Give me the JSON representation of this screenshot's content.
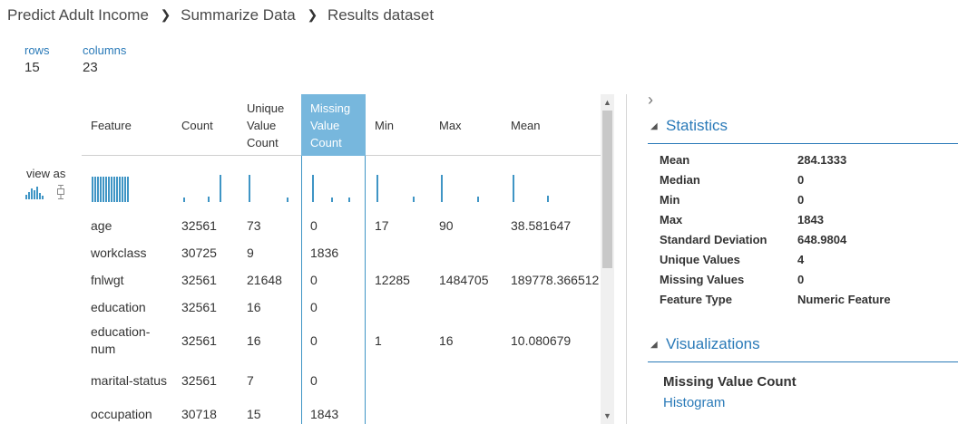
{
  "breadcrumb": [
    "Predict Adult Income",
    "Summarize Data",
    "Results dataset"
  ],
  "rows": {
    "label": "rows",
    "value": "15"
  },
  "columns": {
    "label": "columns",
    "value": "23"
  },
  "view_as": "view as",
  "headers": [
    "Feature",
    "Count",
    "Unique Value Count",
    "Missing Value Count",
    "Min",
    "Max",
    "Mean"
  ],
  "selected_column": "Missing Value Count",
  "table_rows": [
    [
      "age",
      "32561",
      "73",
      "0",
      "17",
      "90",
      "38.581647"
    ],
    [
      "workclass",
      "30725",
      "9",
      "1836",
      "",
      "",
      ""
    ],
    [
      "fnlwgt",
      "32561",
      "21648",
      "0",
      "12285",
      "1484705",
      "189778.366512"
    ],
    [
      "education",
      "32561",
      "16",
      "0",
      "",
      "",
      ""
    ],
    [
      "education-num",
      "32561",
      "16",
      "0",
      "1",
      "16",
      "10.080679"
    ],
    [
      "marital-status",
      "32561",
      "7",
      "0",
      "",
      "",
      ""
    ],
    [
      "occupation",
      "30718",
      "15",
      "1843",
      "",
      "",
      ""
    ]
  ],
  "statistics": {
    "title": "Statistics",
    "items": [
      {
        "k": "Mean",
        "v": "284.1333"
      },
      {
        "k": "Median",
        "v": "0"
      },
      {
        "k": "Min",
        "v": "0"
      },
      {
        "k": "Max",
        "v": "1843"
      },
      {
        "k": "Standard Deviation",
        "v": "648.9804"
      },
      {
        "k": "Unique Values",
        "v": "4"
      },
      {
        "k": "Missing Values",
        "v": "0"
      },
      {
        "k": "Feature Type",
        "v": "Numeric Feature"
      }
    ]
  },
  "visualizations": {
    "title": "Visualizations",
    "chart_title": "Missing Value Count",
    "chart_type": "Histogram"
  },
  "colors": {
    "accent": "#2a7ab8",
    "selected_header": "#77b7dd",
    "hist_bar": "#3f95c5"
  },
  "icons": [
    "histogram-icon",
    "boxplot-icon",
    "chevron-right-icon",
    "collapse-triangle-icon",
    "scroll-up-icon",
    "scroll-down-icon"
  ]
}
